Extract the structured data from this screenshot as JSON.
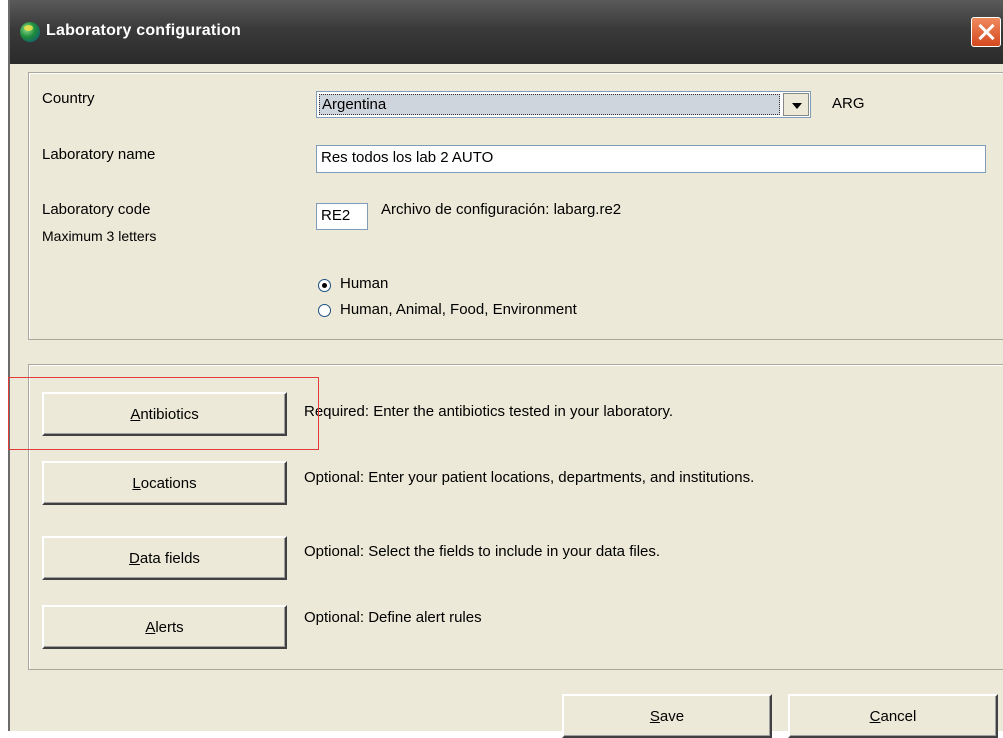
{
  "window": {
    "title": "Laboratory configuration"
  },
  "form": {
    "country_label": "Country",
    "country_value": "Argentina",
    "country_code": "ARG",
    "lab_name_label": "Laboratory name",
    "lab_name_value": "Res todos los lab 2 AUTO",
    "lab_code_label": "Laboratory code",
    "lab_code_hint": "Maximum 3 letters",
    "lab_code_value": "RE2",
    "config_file_text": "Archivo de configuración:  labarg.re2",
    "radio_human": "Human",
    "radio_all": "Human, Animal, Food, Environment",
    "selected_radio": "Human"
  },
  "sections": [
    {
      "button_access": "A",
      "button_rest": "ntibiotics",
      "description": "Required:  Enter the antibiotics tested in your laboratory."
    },
    {
      "button_access": "L",
      "button_rest": "ocations",
      "description": "Optional:  Enter your patient locations, departments, and institutions."
    },
    {
      "button_access": "D",
      "button_rest": "ata fields",
      "description": "Optional:  Select the fields to include in your data files."
    },
    {
      "button_access": "A",
      "button_rest": "lerts",
      "description": "Optional:  Define alert rules"
    }
  ],
  "footer": {
    "save_access": "S",
    "save_rest": "ave",
    "cancel_access": "C",
    "cancel_rest": "ancel"
  },
  "colors": {
    "titlebar": "#3a3a3a",
    "dialog_bg": "#ece9d8",
    "highlight_box": "#e23b3b",
    "close_button": "#d4481f"
  }
}
